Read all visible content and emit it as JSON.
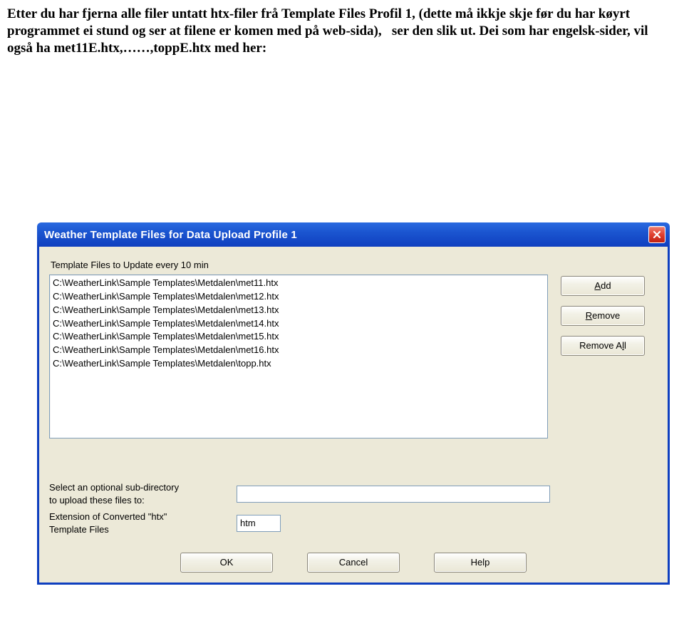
{
  "doc": {
    "p1a": "Etter du har fjerna alle filer untatt htx-filer frå Template Files Profil 1, (dette må ikkje skje før du har køyrt programmet ei stund og ser at filene er komen med på web-sida),",
    "p1b": "ser den slik ut. Dei som har engelsk-sider, vil også ha met11E.htx,……,toppE.htx med her:"
  },
  "dialog": {
    "title": "Weather Template Files for Data Upload Profile 1",
    "section_label": "Template Files to Update every 10 min",
    "files": [
      "C:\\WeatherLink\\Sample Templates\\Metdalen\\met11.htx",
      "C:\\WeatherLink\\Sample Templates\\Metdalen\\met12.htx",
      "C:\\WeatherLink\\Sample Templates\\Metdalen\\met13.htx",
      "C:\\WeatherLink\\Sample Templates\\Metdalen\\met14.htx",
      "C:\\WeatherLink\\Sample Templates\\Metdalen\\met15.htx",
      "C:\\WeatherLink\\Sample Templates\\Metdalen\\met16.htx",
      "C:\\WeatherLink\\Sample Templates\\Metdalen\\topp.htx"
    ],
    "buttons": {
      "add": "Add",
      "remove": "Remove",
      "remove_all": "Remove All",
      "ok": "OK",
      "cancel": "Cancel",
      "help": "Help"
    },
    "subdir_label_1": "Select an optional sub-directory",
    "subdir_label_2": "to upload these files to:",
    "subdir_value": "",
    "ext_label_1": "Extension of Converted \"htx\"",
    "ext_label_2": "Template Files",
    "ext_value": "htm"
  }
}
